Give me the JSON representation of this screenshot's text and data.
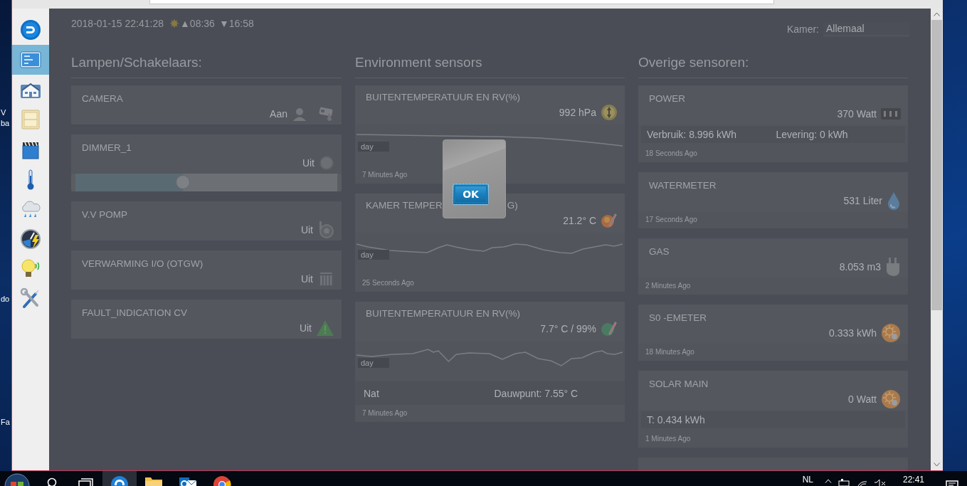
{
  "desktop_labels": [
    "V",
    "ba",
    "do",
    "Fa"
  ],
  "sidebar": {
    "items": [
      {
        "kind": "dashboard",
        "selected": true
      },
      {
        "kind": "floorplan",
        "selected": false
      },
      {
        "kind": "switches",
        "selected": false
      },
      {
        "kind": "scenes",
        "selected": false
      },
      {
        "kind": "temperature",
        "selected": false
      },
      {
        "kind": "weather",
        "selected": false
      },
      {
        "kind": "utility",
        "selected": false
      },
      {
        "kind": "lights",
        "selected": false
      },
      {
        "kind": "setup",
        "selected": false
      }
    ]
  },
  "header": {
    "datetime": "2018-01-15 22:41:28",
    "sunrise": "▲08:36",
    "sunset": "▼16:58",
    "room_label": "Kamer:",
    "room_value": "Allemaal"
  },
  "columns": [
    {
      "heading": "Lampen/Schakelaars:",
      "cards": [
        {
          "kind": "switch",
          "title": "CAMERA",
          "status": "Aan",
          "icon": {
            "kind": "camera"
          }
        },
        {
          "kind": "dimmer",
          "title": "DIMMER_1",
          "status": "Uit",
          "icon": {
            "kind": "dimmer"
          },
          "level": 0.41
        },
        {
          "kind": "switch",
          "title": "V.V POMP",
          "status": "Uit",
          "icon": {
            "kind": "pump"
          }
        },
        {
          "kind": "switch",
          "title": "VERWARMING I/O (OTGW)",
          "status": "Uit",
          "icon": {
            "kind": "radiator"
          }
        },
        {
          "kind": "switch",
          "title": "FAULT_INDICATION CV",
          "status": "Uit",
          "icon": {
            "kind": "warning"
          }
        }
      ]
    },
    {
      "heading": "Environment sensors",
      "cards": [
        {
          "kind": "chart",
          "title": "BUITENTEMPERATUUR EN RV(%)",
          "value": "992 hPa",
          "icon": {
            "kind": "barometer"
          },
          "sparkline": {
            "kind": "pressure"
          },
          "range": "day",
          "updated": "7 Minutes Ago"
        },
        {
          "kind": "chart",
          "title_parts": [
            "KAMER TEMPER",
            "G)"
          ],
          "value": "21.2° C",
          "icon": {
            "kind": "temp_warm"
          },
          "sparkline": {
            "kind": "room"
          },
          "range": "day",
          "updated": "25 Seconds Ago"
        },
        {
          "kind": "chart",
          "title": "BUITENTEMPERATUUR EN RV(%)",
          "value": "7.7° C / 99%",
          "icon": {
            "kind": "temp_cold"
          },
          "sparkline": {
            "kind": "outdoor"
          },
          "range": "day",
          "details": [
            "Nat",
            "Dauwpunt: 7.55° C"
          ],
          "updated": "7 Minutes Ago"
        }
      ]
    },
    {
      "heading": "Overige sensoren:",
      "cards": [
        {
          "kind": "meter",
          "title": "POWER",
          "value": "370 Watt",
          "icon": {
            "kind": "power"
          },
          "details": [
            "Verbruik: 8.996 kWh",
            "Levering: 0 kWh"
          ],
          "updated": "18 Seconds Ago"
        },
        {
          "kind": "meter",
          "title": "WATERMETER",
          "value": "531 Liter",
          "icon": {
            "kind": "water"
          },
          "updated": "17 Seconds Ago"
        },
        {
          "kind": "meter",
          "title": "GAS",
          "value": "8.053 m3",
          "icon": {
            "kind": "gas"
          },
          "updated": "2 Minutes Ago"
        },
        {
          "kind": "meter",
          "title": "S0 -EMETER",
          "value": "0.333 kWh",
          "icon": {
            "kind": "solar"
          },
          "updated": "18 Minutes Ago"
        },
        {
          "kind": "meter",
          "title": "SOLAR MAIN",
          "value": "0 Watt",
          "icon": {
            "kind": "solar"
          },
          "details": [
            "T: 0.434 kWh"
          ],
          "updated": "1 Minutes Ago"
        },
        {
          "kind": "cut"
        }
      ]
    }
  ],
  "popup": {
    "button": "OK"
  },
  "taskbar": {
    "apps": [
      {
        "kind": "start",
        "selected": false
      },
      {
        "kind": "search",
        "selected": false
      },
      {
        "kind": "taskview",
        "selected": false
      },
      {
        "kind": "edge",
        "selected": true
      },
      {
        "kind": "folder",
        "selected": false
      },
      {
        "kind": "mail",
        "selected": false
      },
      {
        "kind": "chrome",
        "selected": false
      }
    ],
    "language": "NL",
    "time": "22:41"
  }
}
